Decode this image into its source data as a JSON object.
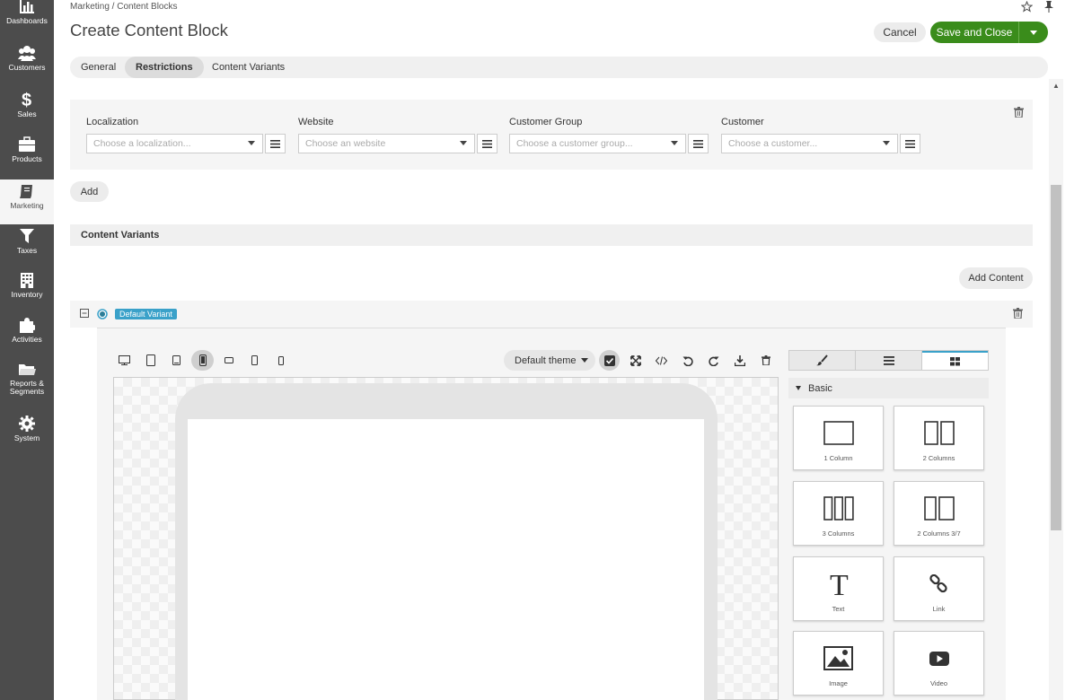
{
  "nav": [
    {
      "label": "Dashboards",
      "icon": "bar-chart-icon"
    },
    {
      "label": "Customers",
      "icon": "users-icon"
    },
    {
      "label": "Sales",
      "icon": "dollar-icon"
    },
    {
      "label": "Products",
      "icon": "briefcase-icon"
    },
    {
      "label": "Marketing",
      "icon": "book-icon"
    },
    {
      "label": "Taxes",
      "icon": "filter-icon"
    },
    {
      "label": "Inventory",
      "icon": "building-icon"
    },
    {
      "label": "Activities",
      "icon": "puzzle-icon"
    },
    {
      "label": "Reports & Segments",
      "icon": "folder-icon"
    },
    {
      "label": "System",
      "icon": "gear-icon"
    }
  ],
  "header": {
    "breadcrumb": "Marketing / Content Blocks",
    "title": "Create Content Block",
    "cancel_label": "Cancel",
    "save_label": "Save and Close"
  },
  "tabs": [
    "General",
    "Restrictions",
    "Content Variants"
  ],
  "restrictions": {
    "fields": [
      {
        "label": "Localization",
        "placeholder": "Choose a localization..."
      },
      {
        "label": "Website",
        "placeholder": "Choose an website"
      },
      {
        "label": "Customer Group",
        "placeholder": "Choose a customer group..."
      },
      {
        "label": "Customer",
        "placeholder": "Choose a customer..."
      }
    ],
    "add_label": "Add"
  },
  "content_variants": {
    "title": "Content Variants",
    "add_content_label": "Add Content",
    "default_variant_label": "Default Variant"
  },
  "editor": {
    "theme": "Default theme",
    "category": "Basic",
    "blocks": [
      "1 Column",
      "2 Columns",
      "3 Columns",
      "2 Columns 3/7",
      "Text",
      "Link",
      "Image",
      "Video"
    ]
  },
  "colors": {
    "sidebar": "#4c4c4c",
    "primary": "#3a8c1b",
    "accent": "#3aa1c9"
  }
}
